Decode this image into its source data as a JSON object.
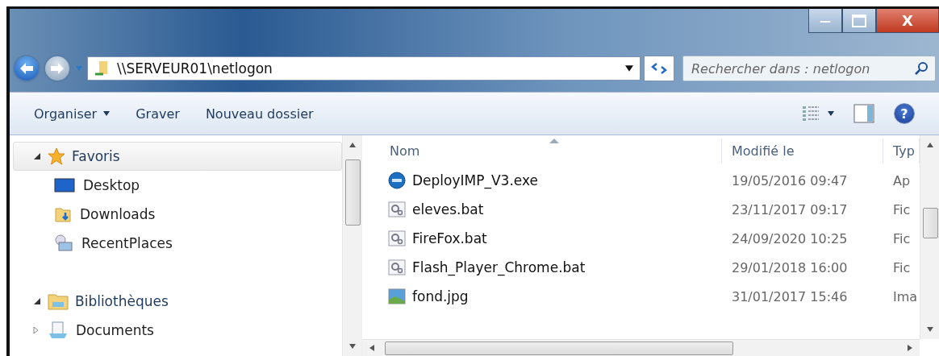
{
  "window": {
    "minimize": "—",
    "close": "X"
  },
  "address": {
    "path": "\\\\SERVEUR01\\netlogon"
  },
  "search": {
    "placeholder": "Rechercher dans : netlogon"
  },
  "toolbar": {
    "items": [
      {
        "label": "Organiser",
        "dropdown": true
      },
      {
        "label": "Graver",
        "dropdown": false
      },
      {
        "label": "Nouveau dossier",
        "dropdown": false
      }
    ],
    "help": "?"
  },
  "sidebar": {
    "groups": [
      {
        "label": "Favoris",
        "kind": "favorites",
        "expanded": true,
        "hovered": true,
        "children": [
          {
            "label": "Desktop",
            "kind": "desktop"
          },
          {
            "label": "Downloads",
            "kind": "downloads"
          },
          {
            "label": "RecentPlaces",
            "kind": "recent"
          }
        ]
      },
      {
        "label": "Bibliothèques",
        "kind": "libraries",
        "expanded": true,
        "hovered": false,
        "children": [
          {
            "label": "Documents",
            "kind": "documents",
            "expanded": false
          }
        ]
      }
    ]
  },
  "table": {
    "columns": [
      "Nom",
      "Modifié le",
      "Typ"
    ],
    "rows": [
      {
        "name": "DeployIMP_V3.exe",
        "kind": "exe",
        "modified": "19/05/2016 09:47",
        "type": "Ap"
      },
      {
        "name": "eleves.bat",
        "kind": "bat",
        "modified": "23/11/2017 09:17",
        "type": "Fic"
      },
      {
        "name": "FireFox.bat",
        "kind": "bat",
        "modified": "24/09/2020 10:25",
        "type": "Fic"
      },
      {
        "name": "Flash_Player_Chrome.bat",
        "kind": "bat",
        "modified": "29/01/2018 16:00",
        "type": "Fic"
      },
      {
        "name": "fond.jpg",
        "kind": "image",
        "modified": "31/01/2017 15:46",
        "type": "Ima"
      }
    ]
  }
}
